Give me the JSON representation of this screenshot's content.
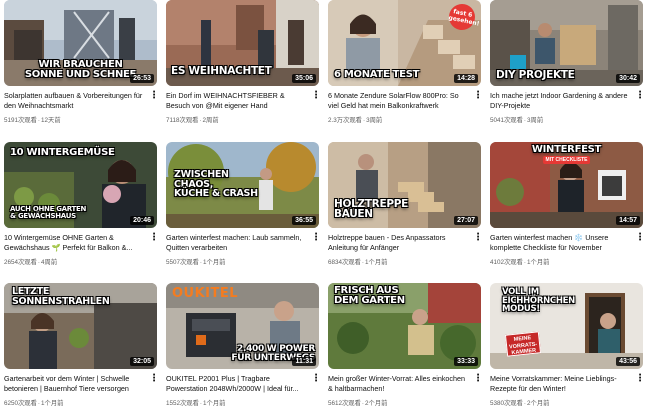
{
  "videos": [
    {
      "overlay": "WIR BRAUCHEN\nSONNE UND SCHNEE",
      "duration": "26:53",
      "title": "Solarplatten aufbauen & Vorbereitungen für den Weihnachtsmarkt",
      "views": "5191次观看",
      "age": "12天前"
    },
    {
      "overlay": "ES WEIHNACHTET",
      "duration": "35:06",
      "title": "Ein Dorf im WEIHNACHTSFIEBER & Besuch von @Mit eigener Hand",
      "views": "7118次观看",
      "age": "2周前"
    },
    {
      "overlay": "6 MONATE TEST",
      "duration": "14:28",
      "badge": "fast 6 gesehen!",
      "title": "6 Monate Zendure SolarFlow 800Pro: So viel Geld hat mein Balkonkraftwerk wirklich...",
      "views": "2.3万次观看",
      "age": "3周前"
    },
    {
      "overlay": "DIY PROJEKTE",
      "duration": "30:42",
      "title": "Ich mache jetzt Indoor Gardening & andere DIY-Projekte",
      "views": "5041次观看",
      "age": "3周前"
    },
    {
      "overlay": "10 WINTERGEMÜSE",
      "overlay2": "AUCH OHNE GARTEN\n& GEWÄCHSHAUS",
      "duration": "20:46",
      "title": "10 Wintergemüse OHNE Garten & Gewächshaus 🌱 Perfekt für Balkon &...",
      "views": "2654次观看",
      "age": "4周前"
    },
    {
      "overlay": "ZWISCHEN\nCHAOS,\nKÜCHE & CRASH",
      "duration": "36:55",
      "title": "Garten winterfest machen: Laub sammeln, Quitten verarbeiten",
      "views": "5507次观看",
      "age": "1个月前"
    },
    {
      "overlay": "HOLZTREPPE\nBAUEN",
      "duration": "27:07",
      "title": "Holztreppe bauen - Des Anpassators Anleitung für Anfänger",
      "views": "6834次观看",
      "age": "1个月前"
    },
    {
      "overlay": "WINTERFEST",
      "sub_badge": "MIT CHECKLISTE",
      "duration": "14:57",
      "title": "Garten winterfest machen ❄️ Unsere komplette Checkliste für November",
      "views": "4102次观看",
      "age": "1个月前"
    },
    {
      "overlay": "LETZTE\nSONNENSTRAHLEN",
      "duration": "32:05",
      "title": "Gartenarbeit vor dem Winter | Schwelle betonieren | Bauernhof Tiere versorgen",
      "views": "6250次观看",
      "age": "1个月前"
    },
    {
      "overlay": "2.400 W POWER\nFÜR UNTERWEGS",
      "brand": "OUKITEL",
      "duration": "11:31",
      "title": "OUKITEL P2001 Plus | Tragbare Powerstation 2048Wh/2000W | Ideal für...",
      "views": "1552次观看",
      "age": "1个月前"
    },
    {
      "overlay": "FRISCH AUS\nDEM GARTEN",
      "duration": "33:33",
      "title": "Mein großer Winter-Vorrat: Alles einkochen & haltbarmachen!",
      "views": "5612次观看",
      "age": "2个月前"
    },
    {
      "overlay": "VOLL IM\nEICHHÖRNCHEN\nMODUS!",
      "stamp": "MEINE\nVORRATS-\nKAMMER",
      "duration": "43:56",
      "title": "Meine Vorratskammer: Meine Lieblings-Rezepte für den Winter!",
      "views": "5380次观看",
      "age": "2个月前"
    }
  ],
  "more_icon": "more-vert-icon",
  "separator": "·"
}
